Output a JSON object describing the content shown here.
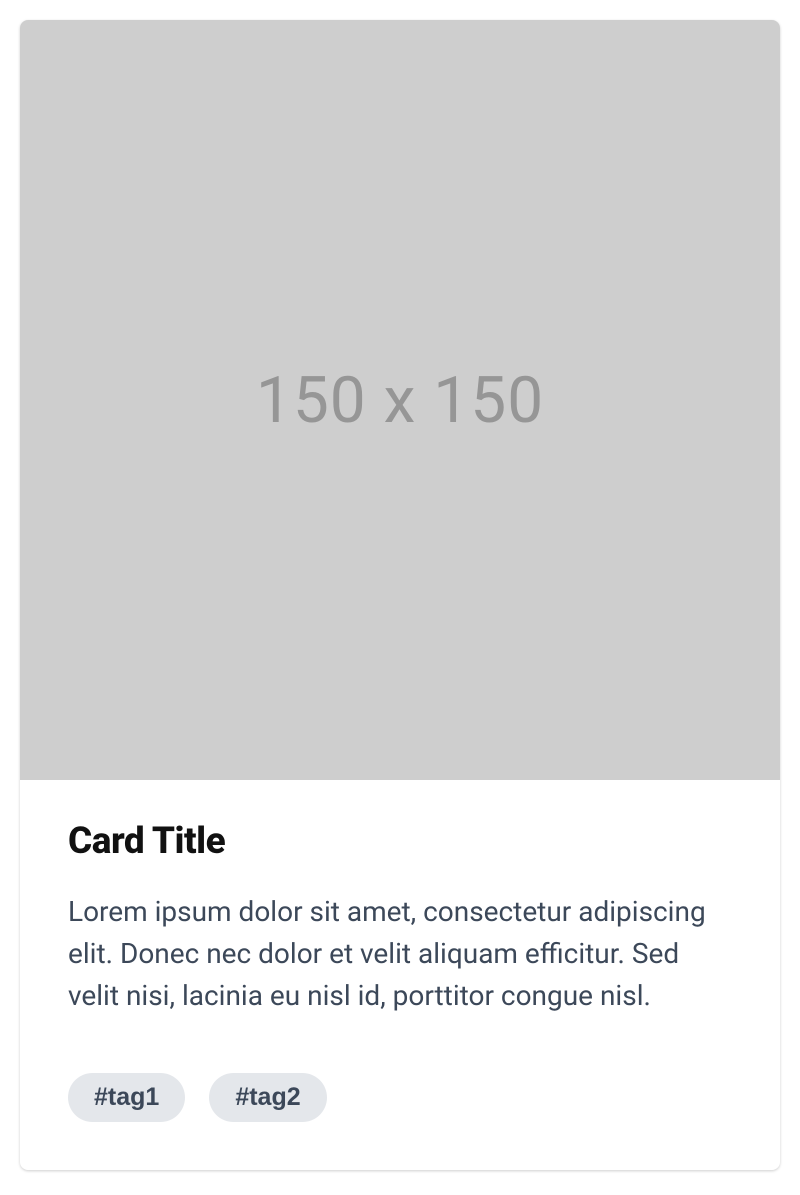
{
  "card": {
    "image_placeholder_text": "150 x 150",
    "title": "Card Title",
    "description": "Lorem ipsum dolor sit amet, consectetur adipiscing elit. Donec nec dolor et velit aliquam efficitur. Sed velit nisi, lacinia eu nisl id, porttitor congue nisl.",
    "tags": [
      "#tag1",
      "#tag2"
    ]
  }
}
